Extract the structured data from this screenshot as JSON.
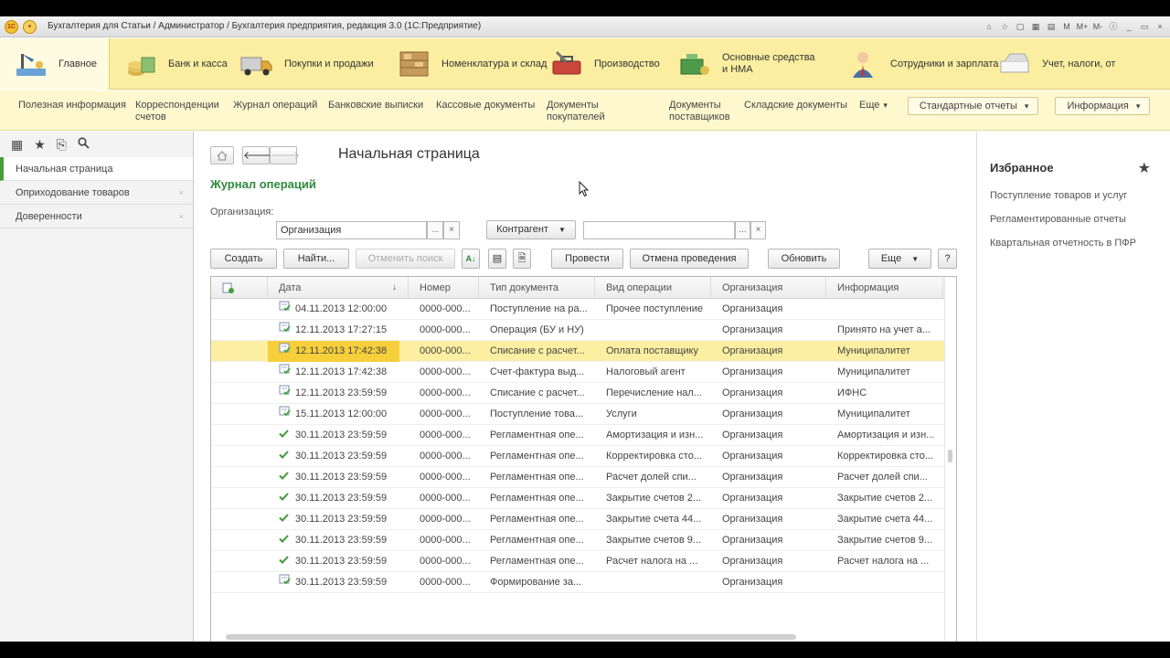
{
  "window": {
    "title": "Бухгалтерия для Статьи / Администратор / Бухгалтерия предприятия, редакция 3.0  (1С:Предприятие)",
    "app_badge": "1С",
    "toolbar_icons": [
      "home-icon",
      "star-icon",
      "copy-icon",
      "calculator-icon",
      "calendar-icon",
      "m-memory-icon",
      "m-plus-icon",
      "m-minus-icon",
      "info-icon",
      "minimize-icon",
      "restore-icon",
      "close-icon"
    ],
    "toolbar_glyphs": [
      "⌂",
      "☆",
      "▢",
      "▦",
      "▤",
      "M",
      "M+",
      "M-",
      "ⓘ",
      "_",
      "▭",
      "×"
    ]
  },
  "sections": [
    {
      "label": "Главное",
      "icon": "main-desk-icon",
      "active": true
    },
    {
      "label": "Банк и касса",
      "icon": "bank-cash-icon"
    },
    {
      "label": "Покупки и продажи",
      "icon": "truck-icon"
    },
    {
      "label": "Номенклатура и склад",
      "icon": "warehouse-icon"
    },
    {
      "label": "Производство",
      "icon": "toolbox-icon"
    },
    {
      "label": "Основные средства и НМА",
      "icon": "assets-icon"
    },
    {
      "label": "Сотрудники и зарплата",
      "icon": "employee-icon"
    },
    {
      "label": "Учет, налоги, от",
      "icon": "accounting-icon"
    }
  ],
  "commands": [
    "Полезная информация",
    "Корреспонденции счетов",
    "Журнал операций",
    "Банковские выписки",
    "Кассовые документы",
    "Документы покупателей",
    "Документы поставщиков",
    "Складские документы",
    "Еще"
  ],
  "command_buttons": [
    "Стандартные отчеты",
    "Информация"
  ],
  "left_panel": {
    "open_items": [
      {
        "label": "Начальная страница",
        "active": true
      },
      {
        "label": "Оприходование товаров"
      },
      {
        "label": "Доверенности"
      }
    ],
    "close_glyph": "×"
  },
  "main": {
    "page_title": "Начальная страница",
    "journal_title": "Журнал операций",
    "org_label": "Организация:",
    "org_value": "Организация",
    "contractor_label": "Контрагент",
    "contractor_value": "",
    "ellipsis": "...",
    "clear": "×",
    "help": "?",
    "buttons": {
      "create": "Создать",
      "find": "Найти...",
      "cancel_search": "Отменить поиск",
      "post": "Провести",
      "unpost": "Отмена проведения",
      "refresh": "Обновить",
      "more": "Еще"
    }
  },
  "table": {
    "columns": [
      "",
      "Дата",
      "Номер",
      "Тип документа",
      "Вид операции",
      "Организация",
      "Информация"
    ],
    "sort_glyph": "↓",
    "rows": [
      {
        "status": "doc",
        "date": "04.11.2013 12:00:00",
        "number": "0000-000...",
        "doc_type": "Поступление на ра...",
        "operation": "Прочее поступление",
        "org": "Организация",
        "info": ""
      },
      {
        "status": "doc",
        "date": "12.11.2013 17:27:15",
        "number": "0000-000...",
        "doc_type": "Операция (БУ и НУ)",
        "operation": "",
        "org": "Организация",
        "info": "Принято на учет а..."
      },
      {
        "status": "doc",
        "date": "12.11.2013 17:42:38",
        "number": "0000-000...",
        "doc_type": "Списание с расчет...",
        "operation": "Оплата поставщику",
        "org": "Организация",
        "info": "Муниципалитет",
        "selected": true
      },
      {
        "status": "doc",
        "date": "12.11.2013 17:42:38",
        "number": "0000-000...",
        "doc_type": "Счет-фактура выд...",
        "operation": "Налоговый агент",
        "org": "Организация",
        "info": "Муниципалитет"
      },
      {
        "status": "doc",
        "date": "12.11.2013 23:59:59",
        "number": "0000-000...",
        "doc_type": "Списание с расчет...",
        "operation": "Перечисление нал...",
        "org": "Организация",
        "info": "ИФНС"
      },
      {
        "status": "doc",
        "date": "15.11.2013 12:00:00",
        "number": "0000-000...",
        "doc_type": "Поступление това...",
        "operation": "Услуги",
        "org": "Организация",
        "info": "Муниципалитет"
      },
      {
        "status": "check",
        "date": "30.11.2013 23:59:59",
        "number": "0000-000...",
        "doc_type": "Регламентная опе...",
        "operation": "Амортизация и изн...",
        "org": "Организация",
        "info": "Амортизация и изн..."
      },
      {
        "status": "check",
        "date": "30.11.2013 23:59:59",
        "number": "0000-000...",
        "doc_type": "Регламентная опе...",
        "operation": "Корректировка сто...",
        "org": "Организация",
        "info": "Корректировка сто..."
      },
      {
        "status": "check",
        "date": "30.11.2013 23:59:59",
        "number": "0000-000...",
        "doc_type": "Регламентная опе...",
        "operation": "Расчет долей спи...",
        "org": "Организация",
        "info": "Расчет долей спи..."
      },
      {
        "status": "check",
        "date": "30.11.2013 23:59:59",
        "number": "0000-000...",
        "doc_type": "Регламентная опе...",
        "operation": "Закрытие счетов 2...",
        "org": "Организация",
        "info": "Закрытие счетов 2..."
      },
      {
        "status": "check",
        "date": "30.11.2013 23:59:59",
        "number": "0000-000...",
        "doc_type": "Регламентная опе...",
        "operation": "Закрытие счета 44...",
        "org": "Организация",
        "info": "Закрытие счета 44..."
      },
      {
        "status": "check",
        "date": "30.11.2013 23:59:59",
        "number": "0000-000...",
        "doc_type": "Регламентная опе...",
        "operation": "Закрытие счетов 9...",
        "org": "Организация",
        "info": "Закрытие счетов 9..."
      },
      {
        "status": "check",
        "date": "30.11.2013 23:59:59",
        "number": "0000-000...",
        "doc_type": "Регламентная опе...",
        "operation": "Расчет налога на ...",
        "org": "Организация",
        "info": "Расчет налога на ..."
      },
      {
        "status": "doc",
        "date": "30.11.2013 23:59:59",
        "number": "0000-000...",
        "doc_type": "Формирование за...",
        "operation": "",
        "org": "Организация",
        "info": ""
      }
    ]
  },
  "favorites": {
    "title": "Избранное",
    "links": [
      "Поступление товаров и услуг",
      "Регламентированные отчеты",
      "Квартальная отчетность в ПФР"
    ]
  },
  "colors": {
    "sections_bg": "#fbeea1",
    "accent_green": "#2e8a3d",
    "selected_row": "#fcefa1",
    "selected_cell": "#f6cf3a"
  }
}
